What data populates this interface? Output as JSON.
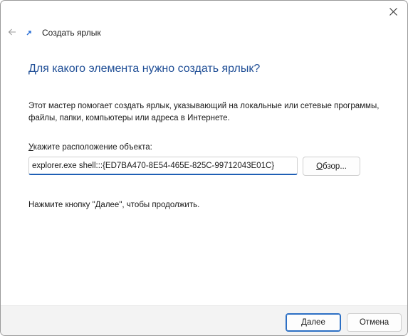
{
  "window": {
    "close_icon": "close-icon"
  },
  "nav": {
    "back_icon": "back-arrow-icon",
    "wizard_icon": "shortcut-arrow-icon",
    "title": "Создать ярлык"
  },
  "main": {
    "heading": "Для какого элемента нужно создать ярлык?",
    "description": "Этот мастер помогает создать ярлык, указывающий на локальные или сетевые программы, файлы, папки, компьютеры или адреса в Интернете.",
    "location_label_access": "У",
    "location_label_rest": "кажите расположение объекта:",
    "location_value": "explorer.exe shell:::{ED7BA470-8E54-465E-825C-99712043E01C}",
    "browse_access": "О",
    "browse_rest": "бзор...",
    "hint": "Нажмите кнопку \"Далее\", чтобы продолжить."
  },
  "footer": {
    "next_access": "Д",
    "next_rest": "алее",
    "cancel_label": "Отмена"
  },
  "colors": {
    "heading": "#1f4e96",
    "accent": "#1f5fb5",
    "footer_bg": "#f3f3f3"
  }
}
